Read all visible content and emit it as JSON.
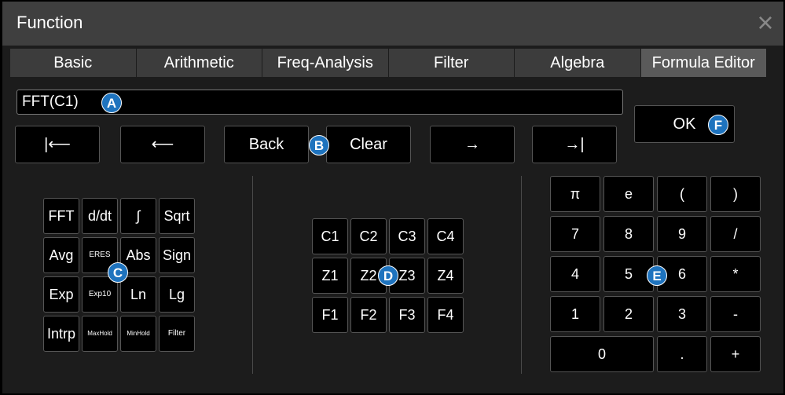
{
  "window": {
    "title": "Function",
    "close_glyph": "×"
  },
  "tabs": [
    {
      "label": "Basic"
    },
    {
      "label": "Arithmetic"
    },
    {
      "label": "Freq-Analysis"
    },
    {
      "label": "Filter"
    },
    {
      "label": "Algebra"
    },
    {
      "label": "Formula Editor",
      "active": true
    }
  ],
  "expression": {
    "value": "FFT(C1)"
  },
  "nav_buttons": [
    "|⟵",
    "⟵",
    "Back",
    "Clear",
    "→",
    "→|"
  ],
  "ok_button": "OK",
  "callouts": {
    "a": "A",
    "b": "B",
    "c": "C",
    "d": "D",
    "e": "E",
    "f": "F"
  },
  "function_keys": [
    [
      "FFT",
      "d/dt",
      "∫",
      "Sqrt"
    ],
    [
      "Avg",
      "ERES",
      "Abs",
      "Sign"
    ],
    [
      "Exp",
      "Exp10",
      "Ln",
      "Lg"
    ],
    [
      "Intrp",
      "MaxHold",
      "MinHold",
      "Filter"
    ]
  ],
  "source_keys": [
    [
      "C1",
      "C2",
      "C3",
      "C4"
    ],
    [
      "Z1",
      "Z2",
      "Z3",
      "Z4"
    ],
    [
      "F1",
      "F2",
      "F3",
      "F4"
    ]
  ],
  "numpad_keys": [
    [
      "π",
      "e",
      "(",
      ")"
    ],
    [
      "7",
      "8",
      "9",
      "/"
    ],
    [
      "4",
      "5",
      "6",
      "*"
    ],
    [
      "1",
      "2",
      "3",
      "-"
    ],
    [
      "0",
      ".",
      "+"
    ]
  ],
  "colors": {
    "accent": "#1e73be",
    "background": "#1c1c1c",
    "titlebar": "#3f3f3f"
  }
}
